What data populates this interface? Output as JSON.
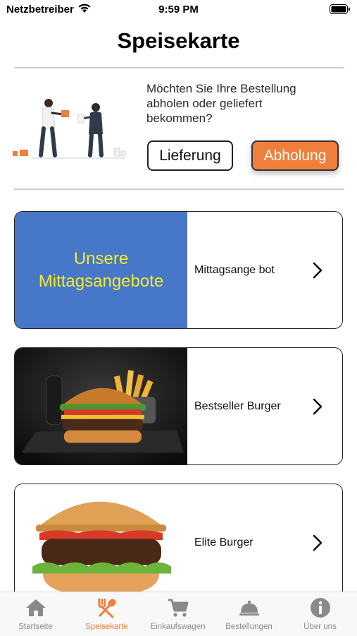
{
  "status_bar": {
    "carrier": "Netzbetreiber",
    "time": "9:59 PM"
  },
  "page": {
    "title": "Speisekarte"
  },
  "order_mode": {
    "question": "Möchten Sie Ihre Bestellung abholen oder geliefert bekommen?",
    "delivery_label": "Lieferung",
    "pickup_label": "Abholung",
    "selected": "Abholung"
  },
  "categories": [
    {
      "label": "Mittagsange bot",
      "image_text": "Unsere Mittagsangebote"
    },
    {
      "label": "Bestseller Burger"
    },
    {
      "label": "Elite Burger"
    }
  ],
  "tabbar": {
    "items": [
      {
        "label": "Startseite",
        "icon": "home-icon"
      },
      {
        "label": "Speisekarte",
        "icon": "fork-spoon-icon",
        "active": true
      },
      {
        "label": "Einkaufswagen",
        "icon": "cart-icon"
      },
      {
        "label": "Bestellungen",
        "icon": "cloche-icon"
      },
      {
        "label": "Über uns",
        "icon": "info-icon"
      }
    ]
  },
  "colors": {
    "accent": "#f07f3c",
    "promo_bg": "#4777c8",
    "promo_text": "#f6ec29"
  }
}
